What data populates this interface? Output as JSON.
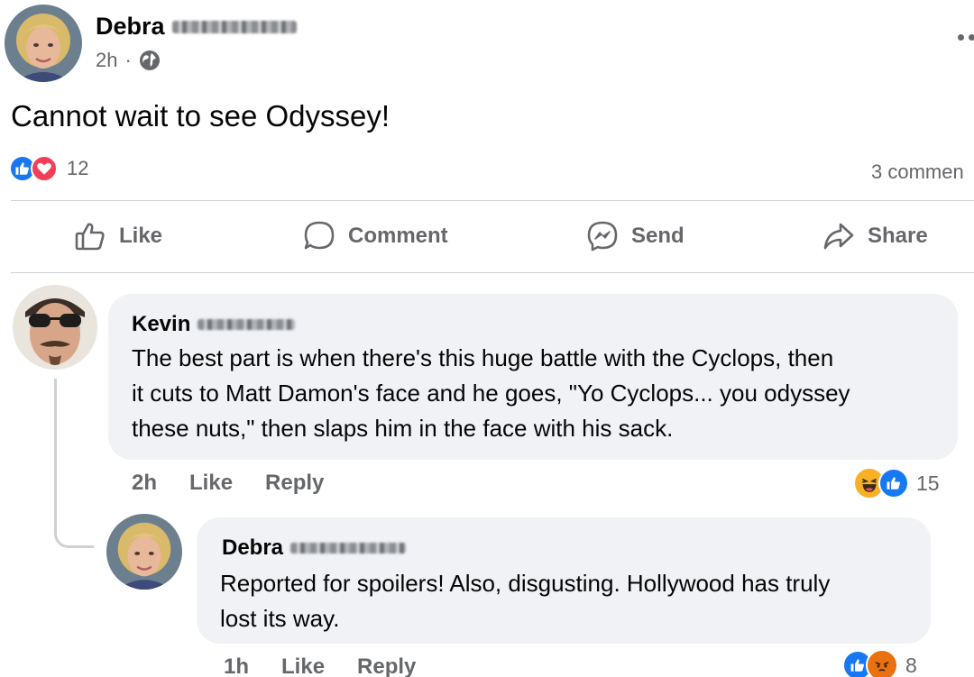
{
  "post": {
    "author": "Debra",
    "time": "2h",
    "separator": "·",
    "privacy_icon": "globe-icon",
    "menu_icon": "more-dots-icon",
    "text": "Cannot wait to see Odyssey!",
    "reactions": [
      "like",
      "love"
    ],
    "reaction_count": "12",
    "comment_count": "3 commen"
  },
  "actions": {
    "like": "Like",
    "comment": "Comment",
    "send": "Send",
    "share": "Share"
  },
  "comments": [
    {
      "author": "Kevin",
      "text_lines": [
        "The best part is when there's this huge battle with the Cyclops, then",
        "it cuts to Matt Damon's face and he goes, \"Yo Cyclops... you odyssey",
        "these nuts,\" then slaps him in the face with his sack."
      ],
      "time": "2h",
      "like": "Like",
      "reply": "Reply",
      "reactions": [
        "haha",
        "like"
      ],
      "reaction_count": "15"
    },
    {
      "author": "Debra",
      "text_lines": [
        "Reported for spoilers! Also, disgusting. Hollywood has truly",
        "lost its way."
      ],
      "time": "1h",
      "like": "Like",
      "reply": "Reply",
      "reactions": [
        "like",
        "angry"
      ],
      "reaction_count": "8"
    }
  ],
  "colors": {
    "like_blue": "#1877f2",
    "love_red": "#f33e58",
    "haha_yellow": "#f7b125",
    "angry_orange": "#e9710f",
    "secondary_text": "#65676b",
    "bubble_bg": "#f0f2f5"
  }
}
